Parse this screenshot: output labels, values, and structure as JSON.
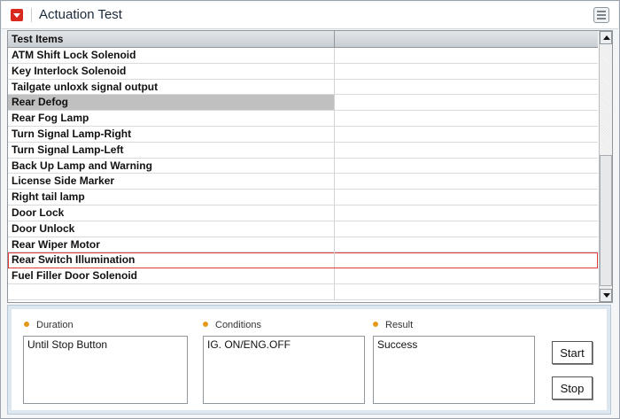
{
  "header": {
    "title": "Actuation Test"
  },
  "table": {
    "column_header": "Test Items",
    "rows": [
      "ATM Shift Lock Solenoid",
      "Key Interlock Solenoid",
      "Tailgate unloxk signal output",
      "Rear Defog",
      "Rear Fog Lamp",
      "Turn Signal Lamp-Right",
      "Turn Signal Lamp-Left",
      "Back Up Lamp and Warning",
      "License Side Marker",
      "Right tail lamp",
      "Door Lock",
      "Door Unlock",
      "Rear Wiper Motor",
      "Rear Switch Illumination",
      "Fuel Filler Door Solenoid",
      ""
    ],
    "selected_row": "Rear Defog",
    "focused_row": "Rear Switch Illumination"
  },
  "fields": {
    "duration": {
      "label": "Duration",
      "value": "Until Stop Button"
    },
    "conditions": {
      "label": "Conditions",
      "value": "IG. ON/ENG.OFF"
    },
    "result": {
      "label": "Result",
      "value": "Success"
    }
  },
  "buttons": {
    "start": "Start",
    "stop": "Stop"
  },
  "colors": {
    "accent": "#d9291f",
    "bullet": "#e59a19",
    "selection": "#c0c0c0",
    "focus_outline": "#e03a3a"
  }
}
